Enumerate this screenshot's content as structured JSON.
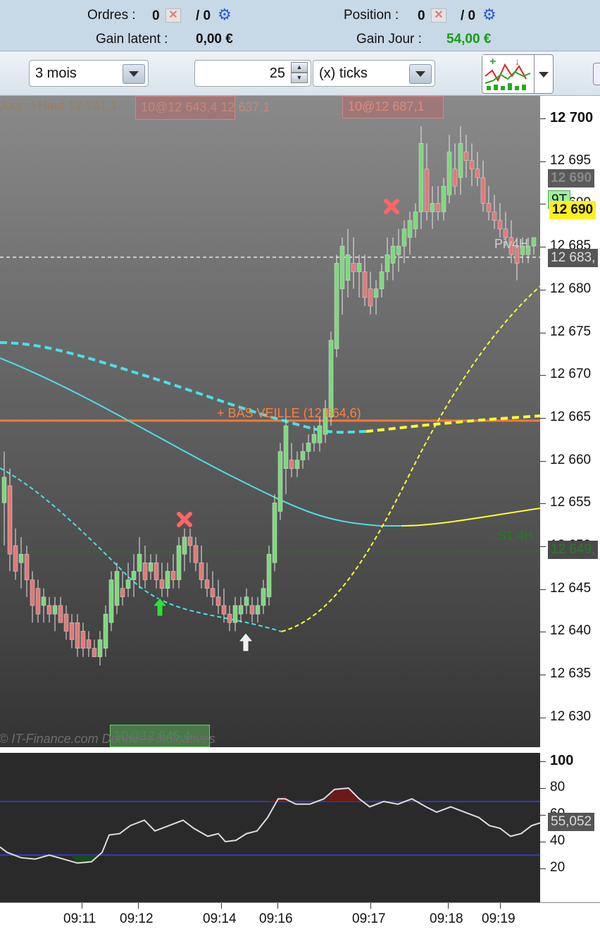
{
  "header": {
    "orders_label": "Ordres :",
    "orders_count": "0",
    "orders_sep": "/ 0",
    "position_label": "Position :",
    "position_count": "0",
    "position_sep": "/ 0",
    "gain_latent_label": "Gain latent :",
    "gain_latent_value": "0,00 €",
    "gain_jour_label": "Gain Jour :",
    "gain_jour_value": "54,00 €",
    "gain_jour_color": "#12a012"
  },
  "toolbar": {
    "period": "3 mois",
    "quantity": "25",
    "unit": "(x) ticks"
  },
  "chart": {
    "top_left_label": "Jour :+Haut 12 741,1",
    "overlay_label": "10@12 643,4 12 637,1",
    "order_label_top": "10@12 687,1",
    "order_label_bottom": "10@12 645,4",
    "bas_veille_label": "+ BAS VEILLE (12 664,6)",
    "s1_label": "S1 4H",
    "pivot_label": "Piv4H",
    "watermark": "© IT-Finance.com Données indicatives",
    "price_ticks": [
      "12 700",
      "12 695",
      "12 690",
      "12 685",
      "12 680",
      "12 675",
      "12 670",
      "12 665",
      "12 660",
      "12 655",
      "12 650",
      "12 645",
      "12 640",
      "12 635",
      "12 630"
    ],
    "tag_upper": "12 690",
    "tag_9t": "9T",
    "tag_current": "12 690",
    "tag_pivot": "12 683,",
    "tag_s1": "12 649,",
    "indicator_ticks": [
      "100",
      "80",
      "60",
      "40",
      "20"
    ],
    "indicator_value": "55,052",
    "time_ticks": [
      "09:11",
      "09:12",
      "09:14",
      "09:16",
      "09:17",
      "09:18",
      "09:19"
    ]
  },
  "colors": {
    "up_candle": "#7ed87e",
    "down_candle": "#e07a7a",
    "cyan": "#49e0e8",
    "yellow": "#ffff33",
    "orange": "#ff7733"
  }
}
